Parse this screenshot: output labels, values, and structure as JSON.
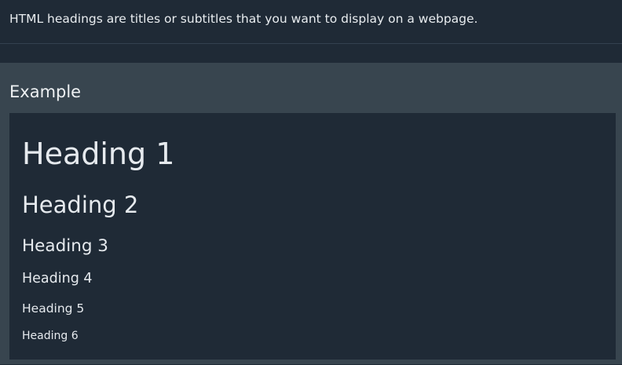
{
  "intro": {
    "text": "HTML headings are titles or subtitles that you want to display on a webpage."
  },
  "example": {
    "title": "Example",
    "headings": [
      "Heading 1",
      "Heading 2",
      "Heading 3",
      "Heading 4",
      "Heading 5",
      "Heading 6"
    ]
  }
}
